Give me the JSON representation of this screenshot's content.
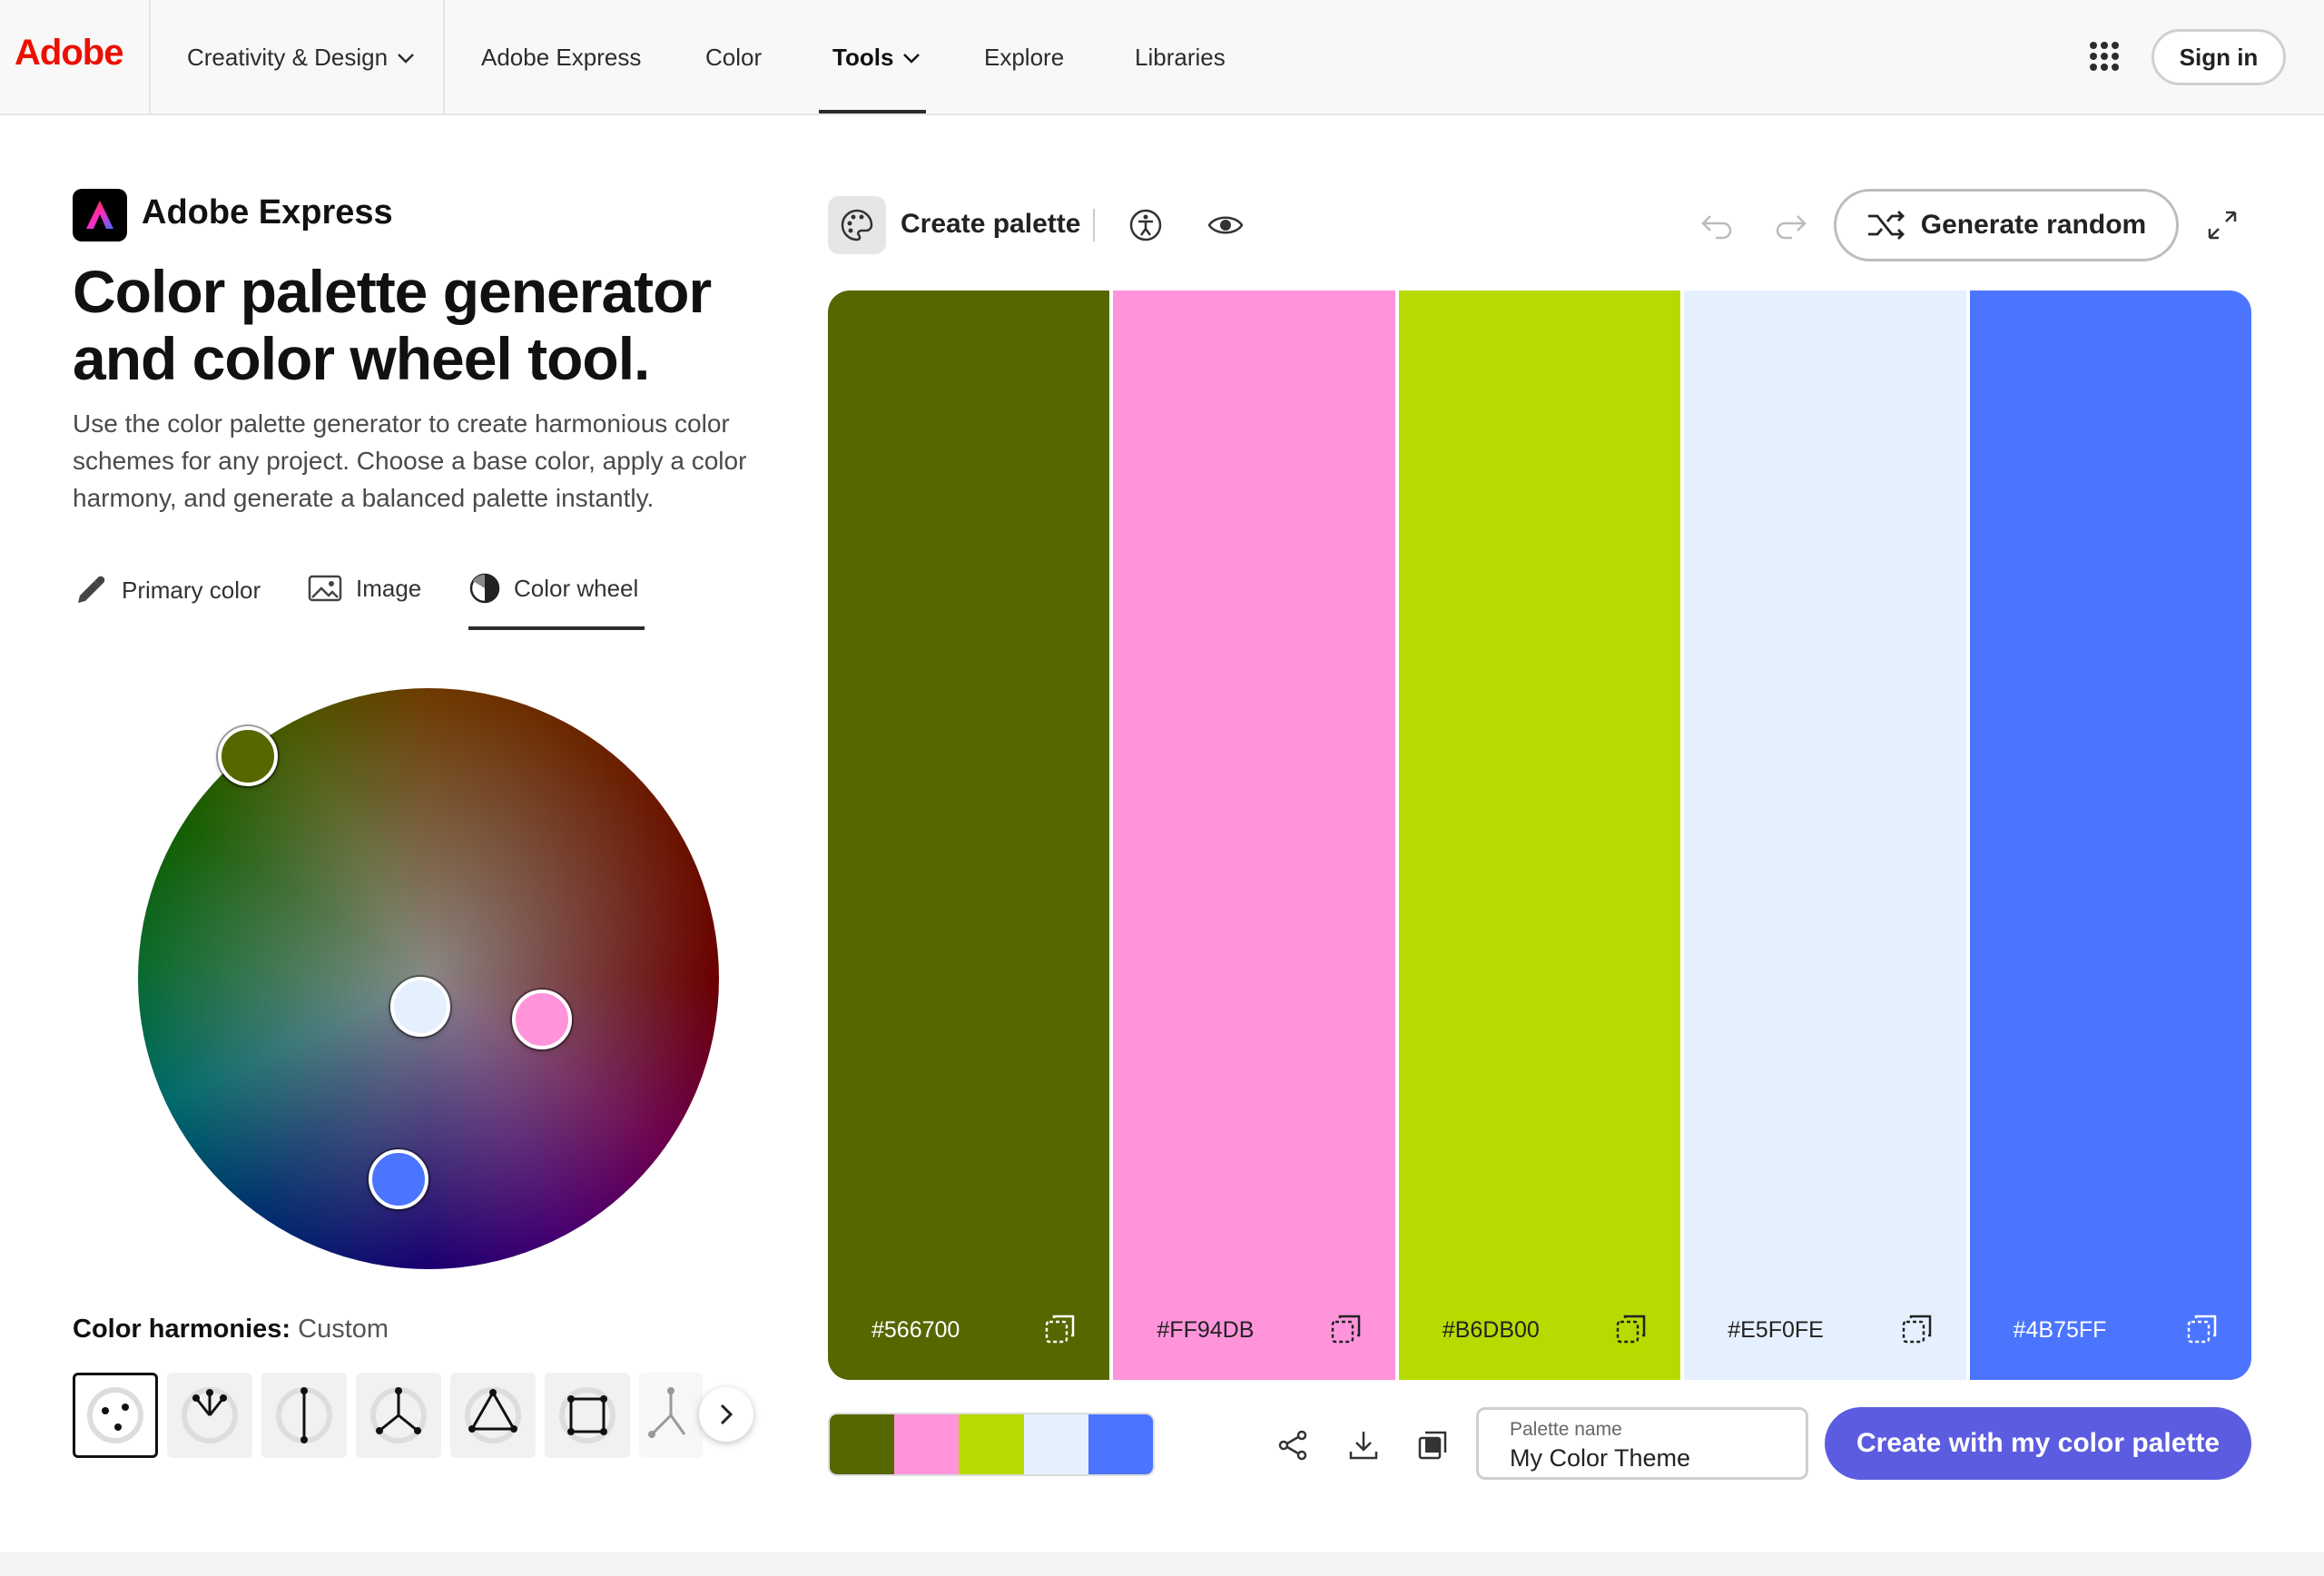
{
  "brand": "Adobe",
  "nav": {
    "items": [
      {
        "label": "Creativity & Design",
        "dropdown": true
      },
      {
        "label": "Adobe Express"
      },
      {
        "label": "Color"
      },
      {
        "label": "Tools",
        "dropdown": true,
        "active": true
      },
      {
        "label": "Explore"
      },
      {
        "label": "Libraries"
      }
    ],
    "sign_in": "Sign in"
  },
  "product": {
    "name": "Adobe Express"
  },
  "hero": {
    "title": "Color palette generator and color wheel tool.",
    "description": "Use the color palette generator to create harmonious color schemes for any project. Choose a base color, apply a color harmony, and generate a balanced palette instantly."
  },
  "tabs": [
    {
      "label": "Primary color",
      "icon": "eyedropper-icon"
    },
    {
      "label": "Image",
      "icon": "image-icon"
    },
    {
      "label": "Color wheel",
      "icon": "color-wheel-icon",
      "active": true
    }
  ],
  "harmonies": {
    "label": "Color harmonies:",
    "value": "Custom",
    "options": [
      "custom",
      "analogous",
      "complementary",
      "split-complementary",
      "triad",
      "square",
      "compound"
    ]
  },
  "toolbar": {
    "create_palette": "Create palette",
    "generate_random": "Generate random"
  },
  "palette": [
    {
      "hex": "#566700",
      "text_color": "#ffffff"
    },
    {
      "hex": "#FF94DB",
      "text_color": "#222222"
    },
    {
      "hex": "#B6DB00",
      "text_color": "#222222"
    },
    {
      "hex": "#E5F0FE",
      "text_color": "#222222"
    },
    {
      "hex": "#4B75FF",
      "text_color": "#ffffff"
    }
  ],
  "palette_name": {
    "label": "Palette name",
    "value": "My Color Theme"
  },
  "create_button": "Create with my color palette",
  "colors": {
    "brand_red": "#eb1000",
    "accent": "#5c5ce0"
  }
}
